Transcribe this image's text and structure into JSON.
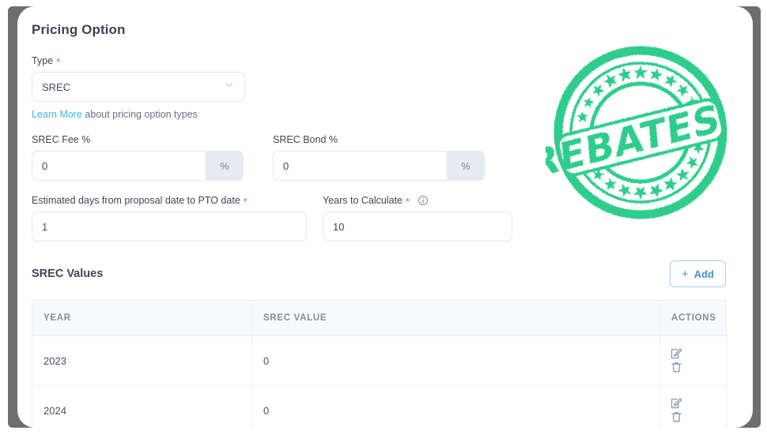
{
  "page": {
    "title": "Pricing Option"
  },
  "type_field": {
    "label": "Type",
    "required_mark": "*",
    "value": "SREC",
    "options": [
      "SREC"
    ],
    "chevron_icon": "chevron-down-icon"
  },
  "helper": {
    "link_text": "Learn More",
    "rest_text": " about pricing option types",
    "link_color": "#46b4e6"
  },
  "srec_fee": {
    "label": "SREC Fee %",
    "value": "0",
    "addon": "%"
  },
  "srec_bond": {
    "label": "SREC Bond %",
    "value": "0",
    "addon": "%"
  },
  "estimated_days": {
    "label": "Estimated days from proposal date to PTO date",
    "required_mark": "*",
    "value": "1"
  },
  "years_to_calculate": {
    "label": "Years to Calculate",
    "required_mark": "*",
    "value": "10",
    "info_icon": "info-circle-icon"
  },
  "srec_values": {
    "section_title": "SREC Values",
    "add_button": {
      "label": "Add",
      "plus": "+"
    },
    "columns": [
      "YEAR",
      "SREC VALUE",
      "ACTIONS"
    ],
    "rows": [
      {
        "year": "2023",
        "value": "0"
      },
      {
        "year": "2024",
        "value": "0"
      }
    ],
    "row_actions": {
      "edit_icon": "edit-pencil-icon",
      "delete_icon": "trash-icon"
    }
  },
  "stamp": {
    "text": "REBATES",
    "color": "#2ecd8c"
  }
}
